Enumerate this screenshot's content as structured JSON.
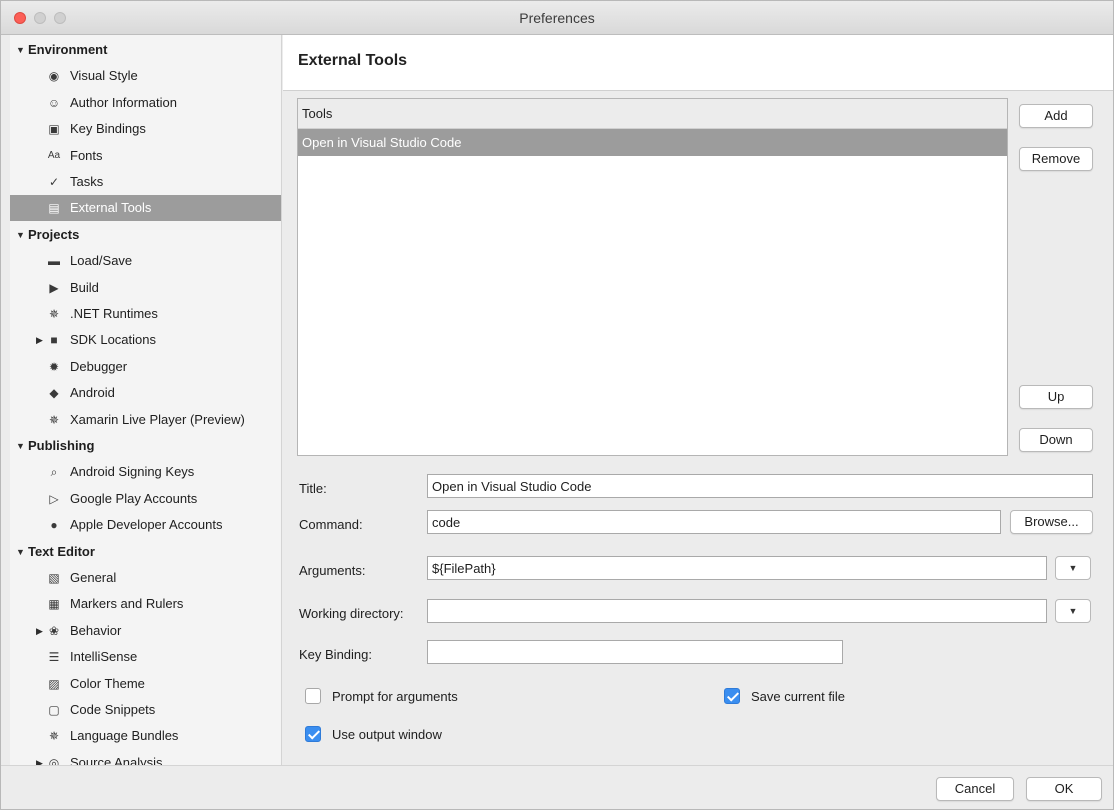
{
  "window": {
    "title": "Preferences"
  },
  "sidebar": {
    "groups": [
      {
        "label": "Environment",
        "items": [
          {
            "label": "Visual Style",
            "icon": "eye-icon"
          },
          {
            "label": "Author Information",
            "icon": "smiley-icon"
          },
          {
            "label": "Key Bindings",
            "icon": "keyboard-icon"
          },
          {
            "label": "Fonts",
            "icon": "fonts-icon",
            "glyph": "Aa"
          },
          {
            "label": "Tasks",
            "icon": "checkmark-icon"
          },
          {
            "label": "External Tools",
            "icon": "terminal-icon",
            "selected": true
          }
        ]
      },
      {
        "label": "Projects",
        "items": [
          {
            "label": "Load/Save",
            "icon": "drive-icon"
          },
          {
            "label": "Build",
            "icon": "build-icon"
          },
          {
            "label": ".NET Runtimes",
            "icon": "gear-icon"
          },
          {
            "label": "SDK Locations",
            "icon": "folder-icon",
            "expandable": true
          },
          {
            "label": "Debugger",
            "icon": "bug-icon"
          },
          {
            "label": "Android",
            "icon": "android-icon"
          },
          {
            "label": "Xamarin Live Player (Preview)",
            "icon": "gear-icon"
          }
        ]
      },
      {
        "label": "Publishing",
        "items": [
          {
            "label": "Android Signing Keys",
            "icon": "key-icon"
          },
          {
            "label": "Google Play Accounts",
            "icon": "play-icon"
          },
          {
            "label": "Apple Developer Accounts",
            "icon": "apple-icon"
          }
        ]
      },
      {
        "label": "Text Editor",
        "items": [
          {
            "label": "General",
            "icon": "general-icon"
          },
          {
            "label": "Markers and Rulers",
            "icon": "grid-icon"
          },
          {
            "label": "Behavior",
            "icon": "brain-icon",
            "expandable": true
          },
          {
            "label": "IntelliSense",
            "icon": "list-icon"
          },
          {
            "label": "Color Theme",
            "icon": "palette-icon"
          },
          {
            "label": "Code Snippets",
            "icon": "snippet-icon"
          },
          {
            "label": "Language Bundles",
            "icon": "gear-icon"
          },
          {
            "label": "Source Analysis",
            "icon": "target-icon",
            "expandable": true
          }
        ]
      }
    ]
  },
  "main": {
    "title": "External Tools",
    "tools_list": {
      "header": "Tools",
      "items": [
        "Open in Visual Studio Code"
      ]
    },
    "buttons": {
      "add": "Add",
      "remove": "Remove",
      "up": "Up",
      "down": "Down",
      "browse": "Browse..."
    },
    "form": {
      "title_label": "Title:",
      "title_value": "Open in Visual Studio Code",
      "command_label": "Command:",
      "command_value": "code",
      "arguments_label": "Arguments:",
      "arguments_value": "${FilePath}",
      "workdir_label": "Working directory:",
      "workdir_value": "",
      "keybinding_label": "Key Binding:",
      "keybinding_value": ""
    },
    "options": {
      "prompt_args": {
        "label": "Prompt for arguments",
        "checked": false
      },
      "save_file": {
        "label": "Save current file",
        "checked": true
      },
      "output_window": {
        "label": "Use output window",
        "checked": true
      }
    }
  },
  "footer": {
    "cancel": "Cancel",
    "ok": "OK"
  },
  "colors": {
    "selection": "#9c9c9c",
    "checkbox_accent": "#3a8ef0",
    "close_button": "#fc5f57"
  }
}
